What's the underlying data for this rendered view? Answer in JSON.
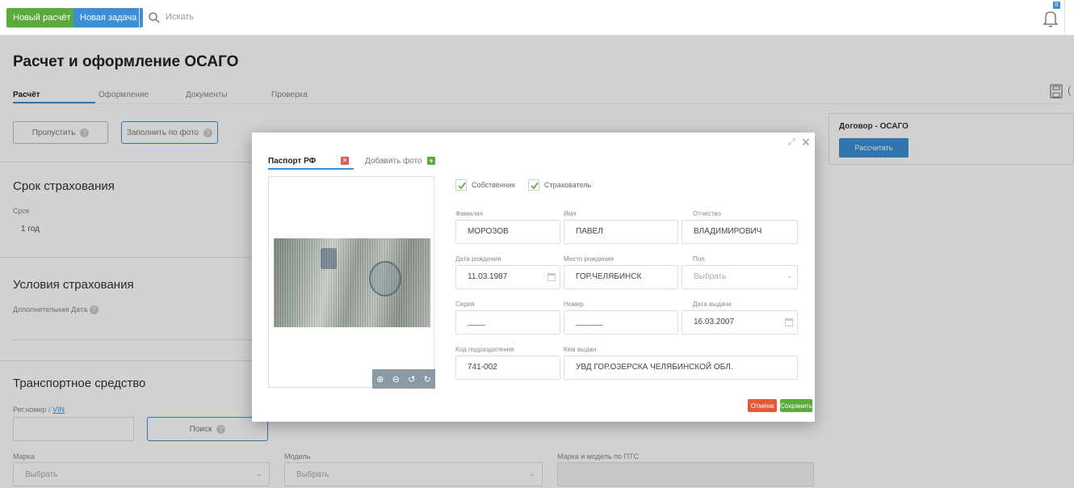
{
  "topbar": {
    "new_calc": "Новый расчёт",
    "new_task": "Новая задача",
    "search_placeholder": "Искать",
    "bell_badge": "0"
  },
  "page": {
    "title": "Расчет и оформление ОСАГО",
    "tabs": [
      "Расчёт",
      "Оформление",
      "Документы",
      "Проверка"
    ]
  },
  "actions": {
    "skip": "Пропустить",
    "fill_by_photo": "Заполнить по фото"
  },
  "contract": {
    "title": "Договор - ОСАГО",
    "calculate": "Рассчитать"
  },
  "sections": {
    "term": {
      "title": "Срок страхования",
      "term_label": "Срок",
      "term_value": "1 год"
    },
    "conditions": {
      "title": "Условия страхования",
      "extra_date_label": "Дополнительная Дата"
    },
    "vehicle": {
      "title": "Транспортное средство",
      "reg_label": "Рег.номер /",
      "vin_label": "VIN",
      "search_button": "Поиск",
      "make_label": "Марка",
      "make_value": "Выбрать",
      "model_label": "Модель",
      "model_value": "Выбрать",
      "pts_label": "Марка и модель по ПТС"
    }
  },
  "modal": {
    "tab_passport": "Паспорт РФ",
    "tab_add_photo": "Добавить фото",
    "owner_label": "Собственник",
    "insurer_label": "Страхователь",
    "fields": {
      "surname_label": "Фамилия",
      "surname": "МОРОЗОВ",
      "name_label": "Имя",
      "name": "ПАВЕЛ",
      "patronymic_label": "Отчество",
      "patronymic": "ВЛАДИМИРОВИЧ",
      "birth_date_label": "Дата рождения",
      "birth_date": "11.03.1987",
      "birth_place_label": "Место рождения",
      "birth_place": "ГОР.ЧЕЛЯБИНСК",
      "sex_label": "Пол",
      "sex": "Выбрать",
      "series_label": "Серия",
      "series": "____",
      "number_label": "Номер",
      "number": "______",
      "issue_date_label": "Дата выдачи",
      "issue_date": "16.03.2007",
      "dept_code_label": "Код подразделения",
      "dept_code": "741-002",
      "issued_by_label": "Кем выдан",
      "issued_by": "УВД ГОР.ОЗЕРСКА ЧЕЛЯБИНСКОЙ ОБЛ."
    },
    "cancel": "Отмена",
    "save": "Сохранить"
  },
  "icons": [
    "search-icon",
    "bell-icon",
    "save-icon",
    "help-icon",
    "zoom-in-icon",
    "zoom-out-icon",
    "rotate-left-icon",
    "rotate-right-icon",
    "expand-icon",
    "close-icon",
    "calendar-icon",
    "chevron-down-icon",
    "check-icon"
  ]
}
